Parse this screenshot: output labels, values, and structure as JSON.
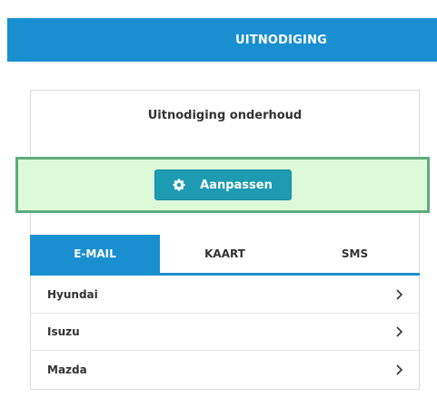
{
  "header": {
    "title": "UITNODIGING"
  },
  "card": {
    "title": "Uitnodiging onderhoud"
  },
  "button": {
    "label": "Aanpassen",
    "icon": "gear-icon"
  },
  "tabs": [
    {
      "label": "E-MAIL",
      "active": true
    },
    {
      "label": "KAART",
      "active": false
    },
    {
      "label": "SMS",
      "active": false
    }
  ],
  "list": [
    {
      "label": "Hyundai"
    },
    {
      "label": "Isuzu"
    },
    {
      "label": "Mazda"
    }
  ],
  "colors": {
    "primary": "#1a8fd0",
    "button": "#1d9bb3",
    "highlight_bg": "#dcf9d8",
    "highlight_border": "#5fab7e"
  }
}
